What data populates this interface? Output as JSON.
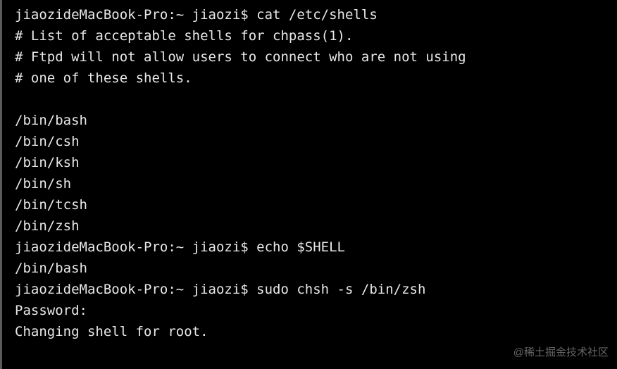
{
  "terminal": {
    "prompt": "jiaozideMacBook-Pro:~ jiaozi$ ",
    "lines": [
      {
        "type": "cmd",
        "command": "cat /etc/shells"
      },
      {
        "type": "out",
        "text": "# List of acceptable shells for chpass(1)."
      },
      {
        "type": "out",
        "text": "# Ftpd will not allow users to connect who are not using"
      },
      {
        "type": "out",
        "text": "# one of these shells."
      },
      {
        "type": "out",
        "text": ""
      },
      {
        "type": "out",
        "text": "/bin/bash"
      },
      {
        "type": "out",
        "text": "/bin/csh"
      },
      {
        "type": "out",
        "text": "/bin/ksh"
      },
      {
        "type": "out",
        "text": "/bin/sh"
      },
      {
        "type": "out",
        "text": "/bin/tcsh"
      },
      {
        "type": "out",
        "text": "/bin/zsh"
      },
      {
        "type": "cmd",
        "command": "echo $SHELL"
      },
      {
        "type": "out",
        "text": "/bin/bash"
      },
      {
        "type": "cmd",
        "command": "sudo chsh -s /bin/zsh"
      },
      {
        "type": "out",
        "text": "Password:"
      },
      {
        "type": "out",
        "text": "Changing shell for root."
      }
    ]
  },
  "watermark": "@稀土掘金技术社区"
}
